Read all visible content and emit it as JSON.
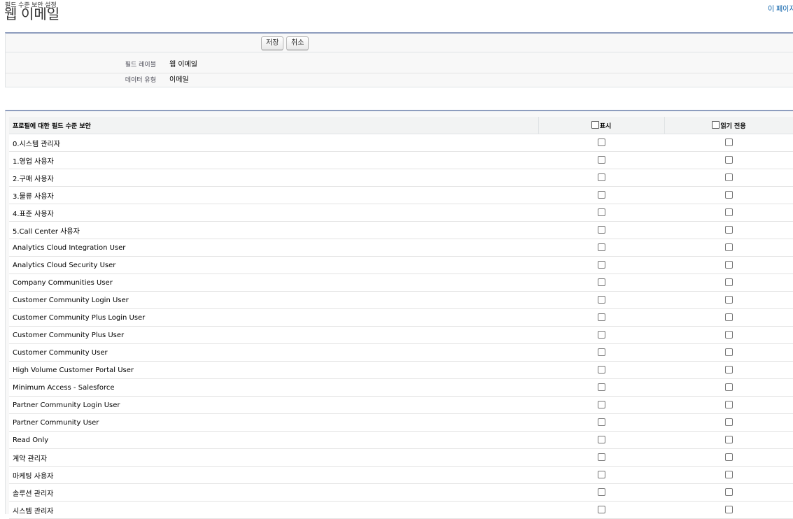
{
  "header": {
    "subtitle": "필드 수준 보안 설정",
    "title": "웹 이메일",
    "help_link": "이 페이지"
  },
  "buttons": {
    "save": "저장",
    "cancel": "취소"
  },
  "details": [
    {
      "label": "필드 레이블",
      "value": "웹 이메일"
    },
    {
      "label": "데이터 유형",
      "value": "이메일"
    }
  ],
  "security_table": {
    "columns": {
      "profile": "프로필에 대한 필드 수준 보안",
      "visible": "표시",
      "read_only": "읽기 전용"
    },
    "rows": [
      {
        "profile": "0.시스템 관리자",
        "visible": false,
        "read_only": false
      },
      {
        "profile": "1.영업 사용자",
        "visible": false,
        "read_only": false
      },
      {
        "profile": "2.구매 사용자",
        "visible": false,
        "read_only": false
      },
      {
        "profile": "3.물류 사용자",
        "visible": false,
        "read_only": false
      },
      {
        "profile": "4.표준 사용자",
        "visible": false,
        "read_only": false
      },
      {
        "profile": "5.Call Center 사용자",
        "visible": false,
        "read_only": false
      },
      {
        "profile": "Analytics Cloud Integration User",
        "visible": false,
        "read_only": false
      },
      {
        "profile": "Analytics Cloud Security User",
        "visible": false,
        "read_only": false
      },
      {
        "profile": "Company Communities User",
        "visible": false,
        "read_only": false
      },
      {
        "profile": "Customer Community Login User",
        "visible": false,
        "read_only": false
      },
      {
        "profile": "Customer Community Plus Login User",
        "visible": false,
        "read_only": false
      },
      {
        "profile": "Customer Community Plus User",
        "visible": false,
        "read_only": false
      },
      {
        "profile": "Customer Community User",
        "visible": false,
        "read_only": false
      },
      {
        "profile": "High Volume Customer Portal User",
        "visible": false,
        "read_only": false
      },
      {
        "profile": "Minimum Access - Salesforce",
        "visible": false,
        "read_only": false
      },
      {
        "profile": "Partner Community Login User",
        "visible": false,
        "read_only": false
      },
      {
        "profile": "Partner Community User",
        "visible": false,
        "read_only": false
      },
      {
        "profile": "Read Only",
        "visible": false,
        "read_only": false
      },
      {
        "profile": "계약 관리자",
        "visible": false,
        "read_only": false
      },
      {
        "profile": "마케팅 사용자",
        "visible": false,
        "read_only": false
      },
      {
        "profile": "솔루션 관리자",
        "visible": false,
        "read_only": false
      },
      {
        "profile": "시스템 관리자",
        "visible": false,
        "read_only": false
      }
    ]
  },
  "colors": {
    "section_border": "#8e9dbe",
    "link": "#015ba7"
  }
}
